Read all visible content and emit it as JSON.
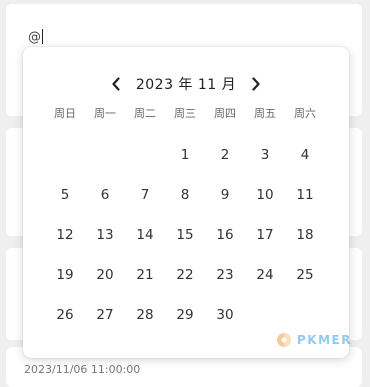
{
  "editor": {
    "text": "@"
  },
  "footer": {
    "timestamp": "2023/11/06 11:00:00"
  },
  "calendar": {
    "year_month": "2023 年 11 月",
    "prev_icon": "chevron-left-icon",
    "next_icon": "chevron-right-icon",
    "weekdays": [
      "周日",
      "周一",
      "周二",
      "周三",
      "周四",
      "周五",
      "周六"
    ],
    "leading_blanks": 3,
    "days": [
      "1",
      "2",
      "3",
      "4",
      "5",
      "6",
      "7",
      "8",
      "9",
      "10",
      "11",
      "12",
      "13",
      "14",
      "15",
      "16",
      "17",
      "18",
      "19",
      "20",
      "21",
      "22",
      "23",
      "24",
      "25",
      "26",
      "27",
      "28",
      "29",
      "30"
    ]
  },
  "watermark": {
    "text": "PKMER",
    "colors": [
      "#f0a24a",
      "#3aa0e0"
    ]
  }
}
